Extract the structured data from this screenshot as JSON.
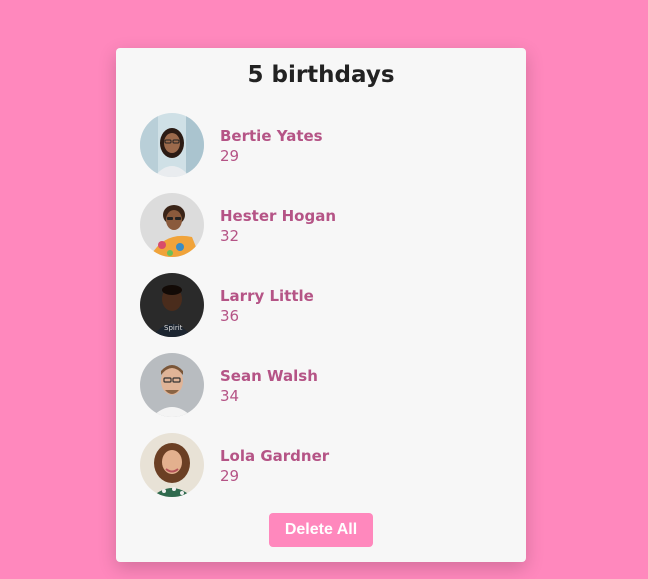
{
  "header": {
    "title": "5 birthdays"
  },
  "people": [
    {
      "name": "Bertie Yates",
      "age": "29",
      "avatar_icon": "woman-with-glasses-avatar"
    },
    {
      "name": "Hester Hogan",
      "age": "32",
      "avatar_icon": "woman-with-sunglasses-avatar"
    },
    {
      "name": "Larry Little",
      "age": "36",
      "avatar_icon": "man-dark-shirt-avatar"
    },
    {
      "name": "Sean Walsh",
      "age": "34",
      "avatar_icon": "man-with-glasses-avatar"
    },
    {
      "name": "Lola Gardner",
      "age": "29",
      "avatar_icon": "woman-curly-hair-avatar"
    }
  ],
  "actions": {
    "delete_all_label": "Delete All"
  },
  "colors": {
    "background": "#ff88bd",
    "card": "#f7f7f7",
    "accent_text": "#b55486",
    "button": "#ff88bd"
  }
}
